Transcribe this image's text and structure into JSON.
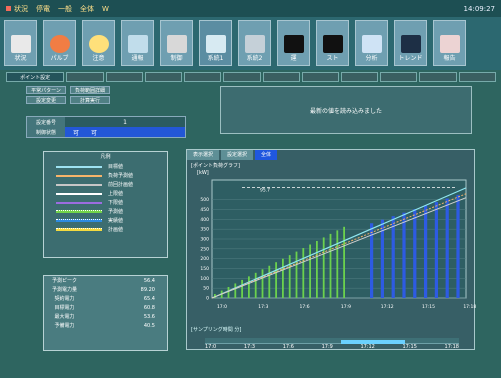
{
  "title": {
    "left_1": "状況",
    "left_2": "停電",
    "mid_1": "一般",
    "mid_2": "全体",
    "right_1": "W",
    "clock": "14:09:27"
  },
  "toolbar": {
    "items": [
      {
        "label": "状況",
        "icon": "status-icon"
      },
      {
        "label": "パルブ",
        "icon": "valve-icon"
      },
      {
        "label": "注意",
        "icon": "face-icon"
      },
      {
        "label": "通報",
        "icon": "alert-icon"
      },
      {
        "label": "制御",
        "icon": "bulb-icon"
      },
      {
        "label": "系統1",
        "icon": "network-icon"
      },
      {
        "label": "系統2",
        "icon": "grid-icon"
      },
      {
        "label": "運",
        "icon": "black-square-icon"
      },
      {
        "label": "スト",
        "icon": "black-square-icon"
      },
      {
        "label": "分析",
        "icon": "chart-icon"
      },
      {
        "label": "トレンド",
        "icon": "trend-icon"
      },
      {
        "label": "報告",
        "icon": "report-icon"
      }
    ]
  },
  "tabs": [
    "ポイント設定",
    "",
    "",
    "",
    "",
    "",
    "",
    "",
    "",
    "",
    "",
    ""
  ],
  "buttons": {
    "b1": "平常パターン",
    "b2": "負荷範囲詳細",
    "b3": "設定変更",
    "b4": "計算実行"
  },
  "message": "最新の値を読み込みました",
  "info": {
    "row1_label": "設定番号",
    "row1_value": "1",
    "row2_label": "制御状態",
    "row2_value": "可",
    "row2_value2": "可"
  },
  "legend": {
    "title": "凡例",
    "rows": [
      {
        "label": "目標値",
        "color": "#9ee2f2"
      },
      {
        "label": "負荷予測値",
        "color": "#f7b46a"
      },
      {
        "label": "前回計画値",
        "color": "#c7c7c7"
      },
      {
        "label": "上限値",
        "color": "#ffffff"
      },
      {
        "label": "下限値",
        "color": "#9b6ce0"
      },
      {
        "label": "予測値",
        "color": "#72d34a"
      },
      {
        "label": "実績値",
        "color": "#2d8be0"
      },
      {
        "label": "計画値",
        "color": "#f3d93f"
      }
    ]
  },
  "summary": {
    "rows": [
      {
        "label": "予測ピーク",
        "value": "56.4"
      },
      {
        "label": "予測電力量",
        "value": "89.20"
      },
      {
        "label": "契約電力",
        "value": "65.4"
      },
      {
        "label": "目標電力",
        "value": "60.8"
      },
      {
        "label": "最大電力",
        "value": "53.6"
      },
      {
        "label": "予備電力",
        "value": "40.5"
      }
    ]
  },
  "chart_tabs": [
    "表示選択",
    "設定選択",
    "全体"
  ],
  "chart_title": "[ポイント負荷グラフ]",
  "chart_unit": "[kW]",
  "footer_title": "[サンプリング時間 分]",
  "chart_data": {
    "type": "bar",
    "ylim": [
      0,
      600
    ],
    "y_ticks": [
      0,
      50,
      100,
      150,
      200,
      250,
      300,
      350,
      400,
      450,
      500,
      550
    ],
    "x_ticks": [
      "17:0",
      "17:3",
      "17:6",
      "17:9",
      "17:12",
      "17:15",
      "17:18"
    ],
    "series": [
      {
        "name": "予測値",
        "values": [
          20,
          38,
          56,
          74,
          92,
          110,
          128,
          146,
          164,
          182,
          200,
          218,
          236,
          254,
          272,
          290,
          308,
          326,
          344,
          362
        ]
      },
      {
        "name": "実績値",
        "values": [
          380,
          398,
          416,
          434,
          452,
          470,
          488,
          506,
          524
        ]
      }
    ],
    "overlay": {
      "label": "95.7",
      "lines": [
        "target",
        "upper",
        "lower"
      ]
    }
  },
  "footer_ticks": [
    "17:0",
    "17:3",
    "17:6",
    "17:9",
    "17:12",
    "17:15",
    "17:18"
  ]
}
